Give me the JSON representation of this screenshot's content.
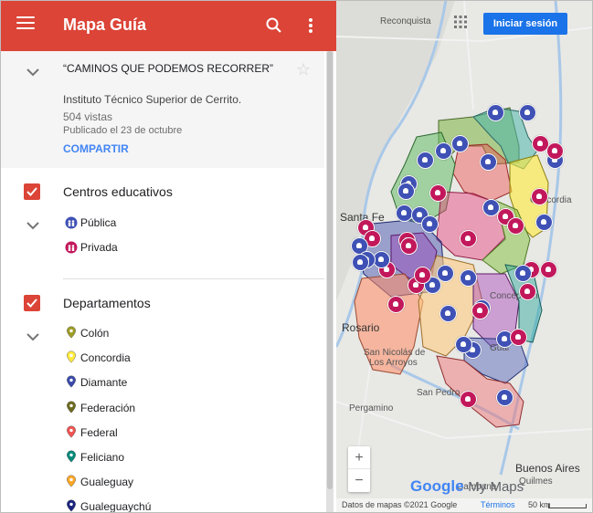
{
  "app": {
    "title": "Mapa Guía",
    "map_title": "“CAMINOS QUE PODEMOS RECORRER”",
    "institution": "Instituto Técnico Superior de Cerrito.",
    "views": "504 vistas",
    "published": "Publicado el 23 de octubre",
    "share_label": "COMPARTIR"
  },
  "layers": [
    {
      "title": "Centros educativos",
      "items": [
        {
          "label": "Pública",
          "color": "#3f51b5",
          "icon": "school-public-icon"
        },
        {
          "label": "Privada",
          "color": "#c2185b",
          "icon": "school-private-icon"
        }
      ]
    },
    {
      "title": "Departamentos",
      "items": [
        {
          "label": "Colón",
          "color": "#9e9d24"
        },
        {
          "label": "Concordia",
          "color": "#ffeb3b"
        },
        {
          "label": "Diamante",
          "color": "#3949ab"
        },
        {
          "label": "Federación",
          "color": "#6d6a1e"
        },
        {
          "label": "Federal",
          "color": "#ef5350"
        },
        {
          "label": "Feliciano",
          "color": "#00897b"
        },
        {
          "label": "Gualeguay",
          "color": "#ffa726"
        },
        {
          "label": "Gualeguaychú",
          "color": "#1a237e"
        }
      ]
    }
  ],
  "map": {
    "signin_label": "Iniciar sesión",
    "zoom_in": "+",
    "zoom_out": "−",
    "brand_google": "Google",
    "brand_mymaps": "My Maps",
    "attribution": "Datos de mapas ©2021 Google",
    "terms": "Términos",
    "scale": "50 km",
    "labels": {
      "reconquista": "Reconquista",
      "santafe": "Santa Fe",
      "rosario": "Rosario",
      "concordia": "Concordia",
      "pergamino": "Pergamino",
      "buenosaires": "Buenos Aires",
      "campana": "Campana",
      "sannicolas": "San Nicolás de",
      "losarroyos": "Los Arroyos",
      "sanpedro": "San Pedro",
      "quilmes": "Quilmes",
      "concepcion": "Concepción",
      "gual": "Gual"
    }
  }
}
